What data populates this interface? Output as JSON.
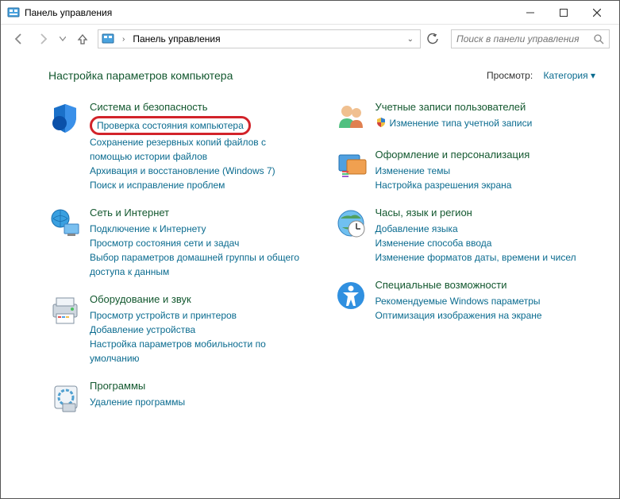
{
  "window": {
    "title": "Панель управления"
  },
  "nav": {
    "breadcrumb": "Панель управления"
  },
  "search": {
    "placeholder": "Поиск в панели управления"
  },
  "header": {
    "title": "Настройка параметров компьютера",
    "viewby_label": "Просмотр:",
    "viewby_value": "Категория"
  },
  "cats": {
    "system": {
      "title": "Система и безопасность",
      "links": [
        "Проверка состояния компьютера",
        "Сохранение резервных копий файлов с помощью истории файлов",
        "Архивация и восстановление (Windows 7)",
        "Поиск и исправление проблем"
      ]
    },
    "network": {
      "title": "Сеть и Интернет",
      "links": [
        "Подключение к Интернету",
        "Просмотр состояния сети и задач",
        "Выбор параметров домашней группы и общего доступа к данным"
      ]
    },
    "hardware": {
      "title": "Оборудование и звук",
      "links": [
        "Просмотр устройств и принтеров",
        "Добавление устройства",
        "Настройка параметров мобильности по умолчанию"
      ]
    },
    "programs": {
      "title": "Программы",
      "links": [
        "Удаление программы"
      ]
    },
    "accounts": {
      "title": "Учетные записи пользователей",
      "links": [
        "Изменение типа учетной записи"
      ]
    },
    "appearance": {
      "title": "Оформление и персонализация",
      "links": [
        "Изменение темы",
        "Настройка разрешения экрана"
      ]
    },
    "clock": {
      "title": "Часы, язык и регион",
      "links": [
        "Добавление языка",
        "Изменение способа ввода",
        "Изменение форматов даты, времени и чисел"
      ]
    },
    "ease": {
      "title": "Специальные возможности",
      "links": [
        "Рекомендуемые Windows параметры",
        "Оптимизация изображения на экране"
      ]
    }
  }
}
